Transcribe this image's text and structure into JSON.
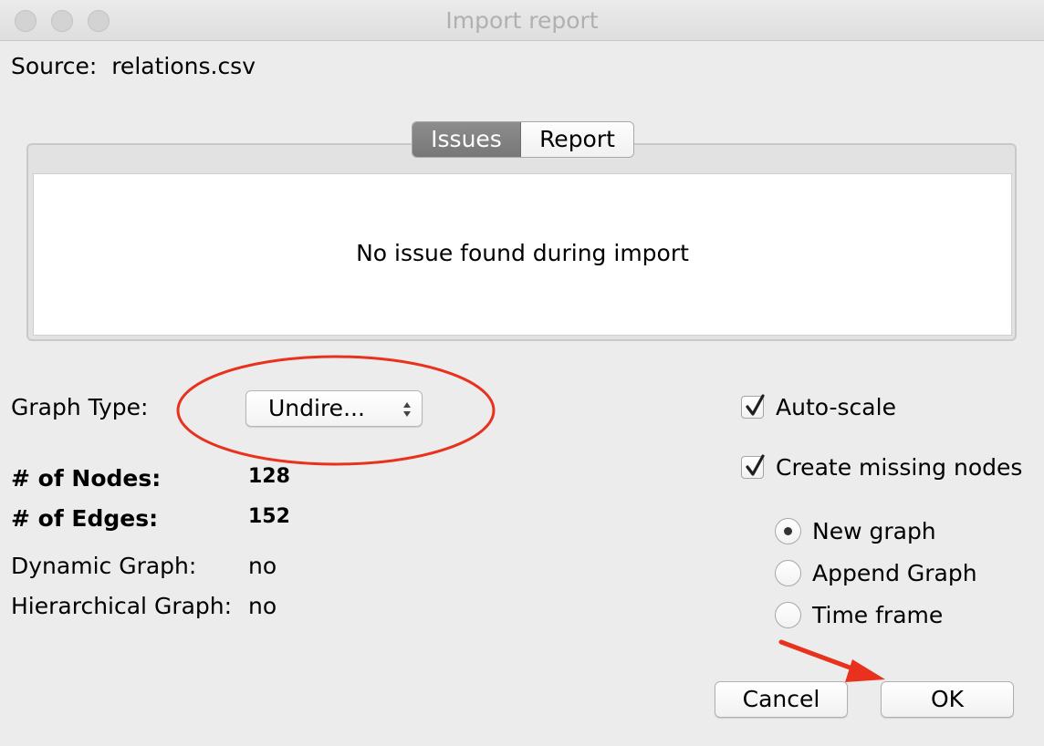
{
  "window": {
    "title": "Import report"
  },
  "source": {
    "label": "Source:",
    "value": "relations.csv"
  },
  "tabs": [
    {
      "label": "Issues",
      "selected": true
    },
    {
      "label": "Report",
      "selected": false
    }
  ],
  "issues_panel": {
    "message": "No issue found during import"
  },
  "graph_type": {
    "label": "Graph Type:",
    "selected_value": "Undire..."
  },
  "stats": {
    "nodes_label": "# of Nodes:",
    "nodes_value": "128",
    "edges_label": "# of Edges:",
    "edges_value": "152",
    "dynamic_label": "Dynamic Graph:",
    "dynamic_value": "no",
    "hierarchical_label": "Hierarchical Graph:",
    "hierarchical_value": "no"
  },
  "options": {
    "auto_scale": {
      "label": "Auto-scale",
      "checked": true
    },
    "create_missing_nodes": {
      "label": "Create missing nodes",
      "checked": true
    }
  },
  "import_mode": [
    {
      "label": "New graph",
      "selected": true
    },
    {
      "label": "Append Graph",
      "selected": false
    },
    {
      "label": "Time frame",
      "selected": false
    }
  ],
  "buttons": {
    "cancel": "Cancel",
    "ok": "OK"
  },
  "colors": {
    "annotation_red": "#e8321e",
    "selected_tab": "#828282",
    "window_bg": "#ececec"
  }
}
